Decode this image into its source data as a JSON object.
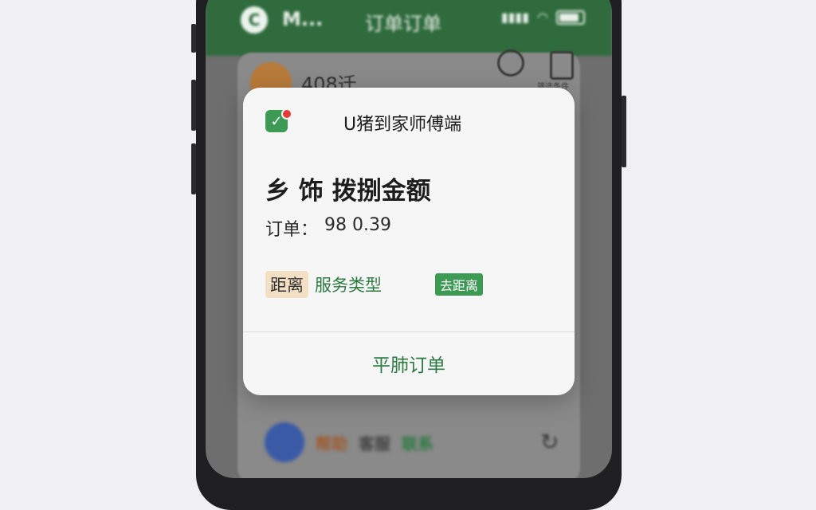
{
  "background_app": {
    "app_name": "M...",
    "logo_letter": "C",
    "header_title": "订单订单",
    "card_name": "408迁",
    "filter_label": "筛选条件",
    "bottom_chip_1": "帮助",
    "bottom_chip_2": "客服",
    "bottom_chip_3": "联系"
  },
  "status_bar": {
    "signal": "▮▮▮▮",
    "wifi": "◠"
  },
  "dialog": {
    "sender": "U猪到家师傅端",
    "title": "乡 饰 拨捌金额",
    "order_label": "订单：",
    "order_value": "98 0.39",
    "tag_distance": "距离",
    "tag_service": "服务类型",
    "tag_go": "去距离",
    "action_label": "平肺订单"
  },
  "colors": {
    "accent_green": "#2e7a43",
    "badge_green": "#3d9a55",
    "tag_peach": "#f3dfc4",
    "notification_red": "#e23b3b"
  },
  "icons": {
    "notification": "check-square-icon",
    "search": "search-icon",
    "filter": "clipboard-icon",
    "battery": "battery-icon"
  }
}
